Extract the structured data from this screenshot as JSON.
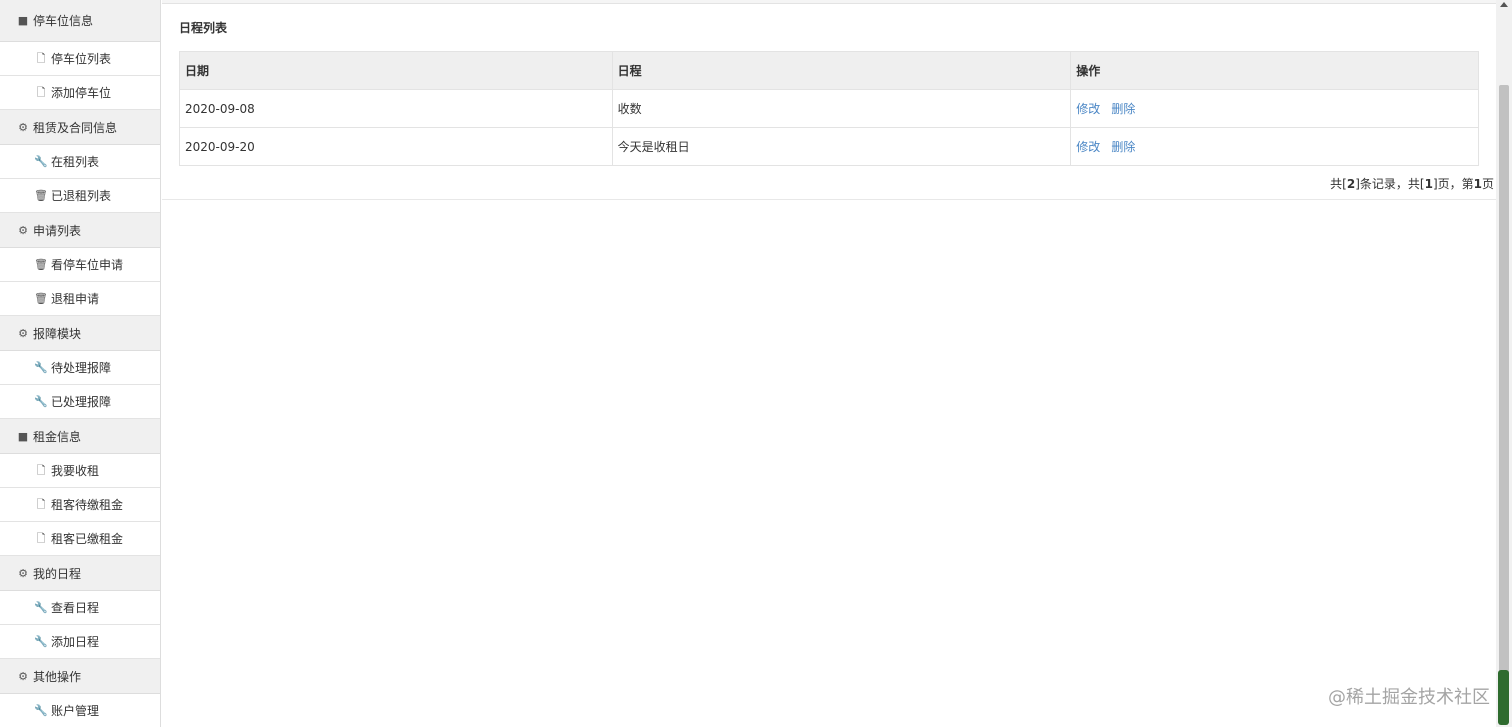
{
  "sidebar": {
    "groups": [
      {
        "label": "停车位信息",
        "icon": "book-icon",
        "items": [
          {
            "label": "停车位列表",
            "icon": "file-icon"
          },
          {
            "label": "添加停车位",
            "icon": "file-icon"
          }
        ]
      },
      {
        "label": "租赁及合同信息",
        "icon": "gear-icon",
        "items": [
          {
            "label": "在租列表",
            "icon": "wrench-icon"
          },
          {
            "label": "已退租列表",
            "icon": "trash-icon"
          }
        ]
      },
      {
        "label": "申请列表",
        "icon": "gear-icon",
        "items": [
          {
            "label": "看停车位申请",
            "icon": "trash-icon"
          },
          {
            "label": "退租申请",
            "icon": "trash-icon"
          }
        ]
      },
      {
        "label": "报障模块",
        "icon": "gear-icon",
        "items": [
          {
            "label": "待处理报障",
            "icon": "wrench-icon"
          },
          {
            "label": "已处理报障",
            "icon": "wrench-icon"
          }
        ]
      },
      {
        "label": "租金信息",
        "icon": "book-icon",
        "items": [
          {
            "label": "我要收租",
            "icon": "file-icon"
          },
          {
            "label": "租客待缴租金",
            "icon": "file-icon"
          },
          {
            "label": "租客已缴租金",
            "icon": "file-icon"
          }
        ]
      },
      {
        "label": "我的日程",
        "icon": "gear-icon",
        "items": [
          {
            "label": "查看日程",
            "icon": "wrench-icon"
          },
          {
            "label": "添加日程",
            "icon": "wrench-icon"
          }
        ]
      },
      {
        "label": "其他操作",
        "icon": "gear-icon",
        "items": [
          {
            "label": "账户管理",
            "icon": "wrench-icon"
          }
        ]
      }
    ]
  },
  "main": {
    "title": "日程列表",
    "columns": {
      "date": "日期",
      "schedule": "日程",
      "actions": "操作"
    },
    "rows": [
      {
        "date": "2020-09-08",
        "schedule": "收数",
        "edit": "修改",
        "delete": "删除"
      },
      {
        "date": "2020-09-20",
        "schedule": "今天是收租日",
        "edit": "修改",
        "delete": "删除"
      }
    ],
    "pager": {
      "p1": "共[",
      "total": "2",
      "p2": "]条记录，共[",
      "pages": "1",
      "p3": "]页，第",
      "current": "1",
      "p4": "页"
    }
  },
  "watermark": "@稀土掘金技术社区",
  "colors": {
    "link": "#4a86c5",
    "header_bg": "#efefef",
    "group_bg": "#f0f0f0"
  }
}
